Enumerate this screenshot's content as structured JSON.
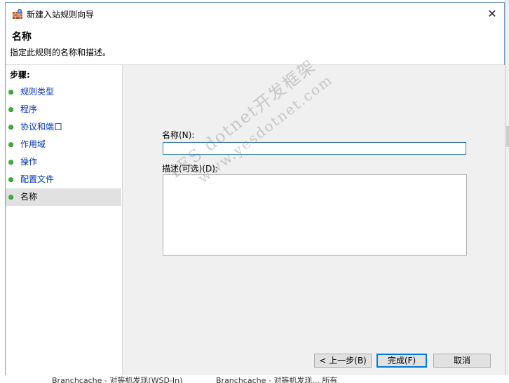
{
  "background": {
    "bottom_text_left": "Branchcache - 对等机发现(WSD-In)",
    "bottom_text_mid": "Branchcache - 对等机发现... 所有"
  },
  "dialog": {
    "title": "新建入站规则向导",
    "close_icon": "close-icon"
  },
  "header": {
    "title": "名称",
    "description": "指定此规则的名称和描述。"
  },
  "steps": {
    "title": "步骤:",
    "items": [
      {
        "label": "规则类型"
      },
      {
        "label": "程序"
      },
      {
        "label": "协议和端口"
      },
      {
        "label": "作用域"
      },
      {
        "label": "操作"
      },
      {
        "label": "配置文件"
      },
      {
        "label": "名称"
      }
    ],
    "active_index": 6
  },
  "form": {
    "name_label": "名称(N):",
    "name_value": "",
    "description_label": "描述(可选)(D):",
    "description_value": ""
  },
  "buttons": {
    "back": "< 上一步(B)",
    "finish": "完成(F)",
    "cancel": "取消"
  },
  "watermark": {
    "line1": "YES dotnet开发框架",
    "line2": "www.yesdotnet.com"
  },
  "colors": {
    "link_blue": "#0033bc",
    "step_dot_green": "#3cb038",
    "focus_blue": "#0078d7",
    "content_bg": "#f0f0f0"
  }
}
